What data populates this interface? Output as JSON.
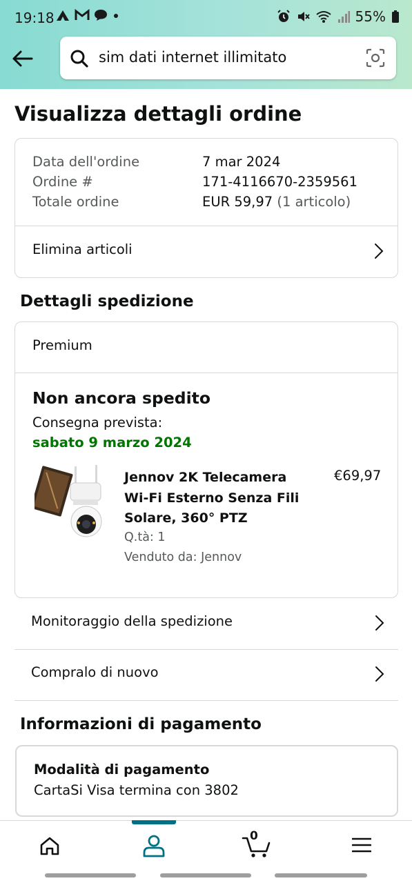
{
  "status_bar": {
    "time": "19:18",
    "battery": "55%",
    "app_icons": [
      "a-icon",
      "m-icon",
      "chat-bubble-icon",
      "dot-icon"
    ],
    "system_icons": [
      "alarm-icon",
      "vibrate-icon",
      "wifi-icon",
      "signal-icon",
      "battery-icon"
    ]
  },
  "search": {
    "query": "sim dati internet illimitato"
  },
  "page": {
    "title": "Visualizza dettagli ordine"
  },
  "order_summary": {
    "date_label": "Data dell'ordine",
    "date_value": "7 mar 2024",
    "number_label": "Ordine #",
    "number_value": "171-4116670-2359561",
    "total_label": "Totale ordine",
    "total_value": "EUR 59,97",
    "total_items": "(1 articolo)",
    "delete_items_label": "Elimina articoli"
  },
  "shipping": {
    "section_title": "Dettagli spedizione",
    "type": "Premium",
    "status": "Non ancora spedito",
    "delivery_label": "Consegna prevista:",
    "delivery_date": "sabato 9 marzo 2024",
    "product": {
      "title": "Jennov 2K Telecamera Wi-Fi Esterno Senza Fili Solare, 360° PTZ",
      "price": "€69,97",
      "quantity": "Q.tà: 1",
      "seller": "Venduto da: Jennov"
    }
  },
  "actions": {
    "track": "Monitoraggio della spedizione",
    "buy_again": "Compralo di nuovo"
  },
  "payment": {
    "section_title": "Informazioni di pagamento",
    "method_title": "Modalità di pagamento",
    "method_value": "CartaSi Visa  termina con 3802"
  },
  "bottom_nav": {
    "cart_count": "0",
    "active": "account",
    "accent_color": "#007185"
  },
  "colors": {
    "delivery_green": "#007600",
    "header_gradient_start": "#87dbd2",
    "header_gradient_end": "#b9e8cd"
  }
}
